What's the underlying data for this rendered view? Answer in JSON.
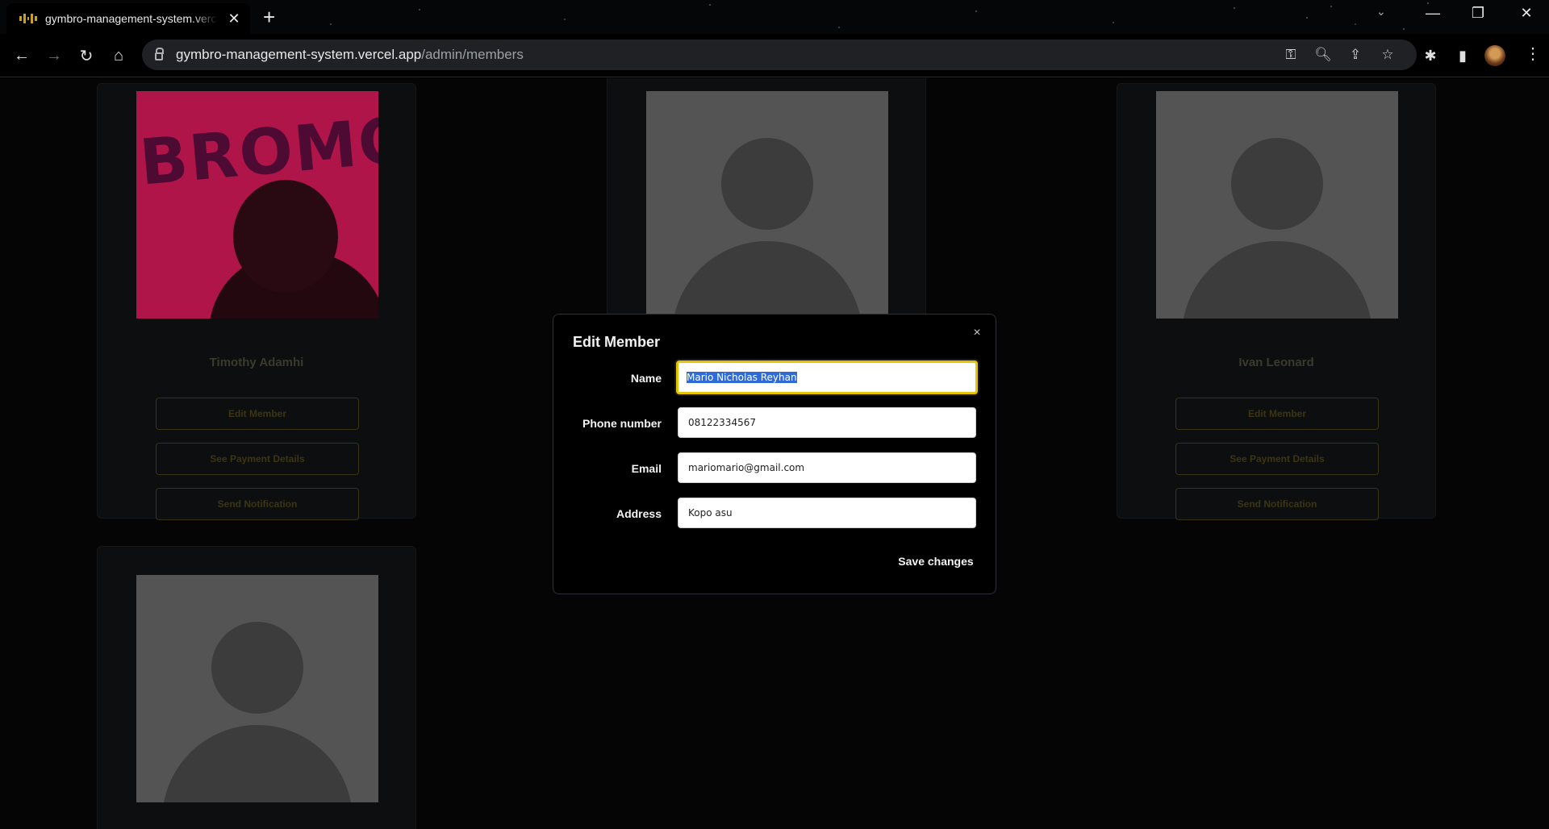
{
  "browser": {
    "tab": {
      "title": "gymbro-management-system.vercel.app/admin/members"
    },
    "address": {
      "host": "gymbro-management-system.vercel.app",
      "path": "/admin/members"
    }
  },
  "page": {
    "cards": [
      {
        "name": "Timothy Adamhi",
        "actions": [
          "Edit Member",
          "See Payment Details",
          "Send Notification"
        ]
      },
      {
        "name": "",
        "actions": []
      },
      {
        "name": "Ivan Leonard",
        "actions": [
          "Edit Member",
          "See Payment Details",
          "Send Notification"
        ]
      },
      {
        "name": "",
        "actions": []
      }
    ]
  },
  "modal": {
    "title": "Edit Member",
    "close": "×",
    "fields": {
      "name": {
        "label": "Name",
        "value": "Mario Nicholas Reyhan"
      },
      "phone": {
        "label": "Phone number",
        "value": "08122334567"
      },
      "email": {
        "label": "Email",
        "value": "mariomario@gmail.com"
      },
      "address": {
        "label": "Address",
        "value": "Kopo asu"
      }
    },
    "save_label": "Save changes"
  },
  "colors": {
    "accent": "#e6c200",
    "selection": "#2f6bd8",
    "background": "#000000"
  }
}
